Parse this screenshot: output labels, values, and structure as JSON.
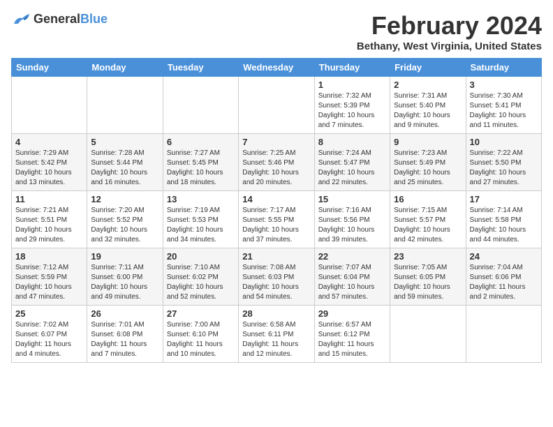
{
  "header": {
    "logo_general": "General",
    "logo_blue": "Blue",
    "month_title": "February 2024",
    "subtitle": "Bethany, West Virginia, United States"
  },
  "days_of_week": [
    "Sunday",
    "Monday",
    "Tuesday",
    "Wednesday",
    "Thursday",
    "Friday",
    "Saturday"
  ],
  "weeks": [
    [
      {
        "day": "",
        "info": ""
      },
      {
        "day": "",
        "info": ""
      },
      {
        "day": "",
        "info": ""
      },
      {
        "day": "",
        "info": ""
      },
      {
        "day": "1",
        "info": "Sunrise: 7:32 AM\nSunset: 5:39 PM\nDaylight: 10 hours\nand 7 minutes."
      },
      {
        "day": "2",
        "info": "Sunrise: 7:31 AM\nSunset: 5:40 PM\nDaylight: 10 hours\nand 9 minutes."
      },
      {
        "day": "3",
        "info": "Sunrise: 7:30 AM\nSunset: 5:41 PM\nDaylight: 10 hours\nand 11 minutes."
      }
    ],
    [
      {
        "day": "4",
        "info": "Sunrise: 7:29 AM\nSunset: 5:42 PM\nDaylight: 10 hours\nand 13 minutes."
      },
      {
        "day": "5",
        "info": "Sunrise: 7:28 AM\nSunset: 5:44 PM\nDaylight: 10 hours\nand 16 minutes."
      },
      {
        "day": "6",
        "info": "Sunrise: 7:27 AM\nSunset: 5:45 PM\nDaylight: 10 hours\nand 18 minutes."
      },
      {
        "day": "7",
        "info": "Sunrise: 7:25 AM\nSunset: 5:46 PM\nDaylight: 10 hours\nand 20 minutes."
      },
      {
        "day": "8",
        "info": "Sunrise: 7:24 AM\nSunset: 5:47 PM\nDaylight: 10 hours\nand 22 minutes."
      },
      {
        "day": "9",
        "info": "Sunrise: 7:23 AM\nSunset: 5:49 PM\nDaylight: 10 hours\nand 25 minutes."
      },
      {
        "day": "10",
        "info": "Sunrise: 7:22 AM\nSunset: 5:50 PM\nDaylight: 10 hours\nand 27 minutes."
      }
    ],
    [
      {
        "day": "11",
        "info": "Sunrise: 7:21 AM\nSunset: 5:51 PM\nDaylight: 10 hours\nand 29 minutes."
      },
      {
        "day": "12",
        "info": "Sunrise: 7:20 AM\nSunset: 5:52 PM\nDaylight: 10 hours\nand 32 minutes."
      },
      {
        "day": "13",
        "info": "Sunrise: 7:19 AM\nSunset: 5:53 PM\nDaylight: 10 hours\nand 34 minutes."
      },
      {
        "day": "14",
        "info": "Sunrise: 7:17 AM\nSunset: 5:55 PM\nDaylight: 10 hours\nand 37 minutes."
      },
      {
        "day": "15",
        "info": "Sunrise: 7:16 AM\nSunset: 5:56 PM\nDaylight: 10 hours\nand 39 minutes."
      },
      {
        "day": "16",
        "info": "Sunrise: 7:15 AM\nSunset: 5:57 PM\nDaylight: 10 hours\nand 42 minutes."
      },
      {
        "day": "17",
        "info": "Sunrise: 7:14 AM\nSunset: 5:58 PM\nDaylight: 10 hours\nand 44 minutes."
      }
    ],
    [
      {
        "day": "18",
        "info": "Sunrise: 7:12 AM\nSunset: 5:59 PM\nDaylight: 10 hours\nand 47 minutes."
      },
      {
        "day": "19",
        "info": "Sunrise: 7:11 AM\nSunset: 6:00 PM\nDaylight: 10 hours\nand 49 minutes."
      },
      {
        "day": "20",
        "info": "Sunrise: 7:10 AM\nSunset: 6:02 PM\nDaylight: 10 hours\nand 52 minutes."
      },
      {
        "day": "21",
        "info": "Sunrise: 7:08 AM\nSunset: 6:03 PM\nDaylight: 10 hours\nand 54 minutes."
      },
      {
        "day": "22",
        "info": "Sunrise: 7:07 AM\nSunset: 6:04 PM\nDaylight: 10 hours\nand 57 minutes."
      },
      {
        "day": "23",
        "info": "Sunrise: 7:05 AM\nSunset: 6:05 PM\nDaylight: 10 hours\nand 59 minutes."
      },
      {
        "day": "24",
        "info": "Sunrise: 7:04 AM\nSunset: 6:06 PM\nDaylight: 11 hours\nand 2 minutes."
      }
    ],
    [
      {
        "day": "25",
        "info": "Sunrise: 7:02 AM\nSunset: 6:07 PM\nDaylight: 11 hours\nand 4 minutes."
      },
      {
        "day": "26",
        "info": "Sunrise: 7:01 AM\nSunset: 6:08 PM\nDaylight: 11 hours\nand 7 minutes."
      },
      {
        "day": "27",
        "info": "Sunrise: 7:00 AM\nSunset: 6:10 PM\nDaylight: 11 hours\nand 10 minutes."
      },
      {
        "day": "28",
        "info": "Sunrise: 6:58 AM\nSunset: 6:11 PM\nDaylight: 11 hours\nand 12 minutes."
      },
      {
        "day": "29",
        "info": "Sunrise: 6:57 AM\nSunset: 6:12 PM\nDaylight: 11 hours\nand 15 minutes."
      },
      {
        "day": "",
        "info": ""
      },
      {
        "day": "",
        "info": ""
      }
    ]
  ]
}
